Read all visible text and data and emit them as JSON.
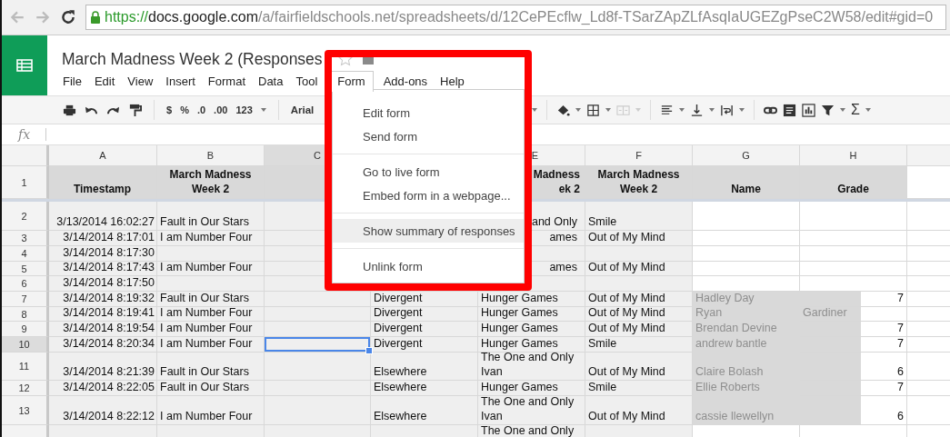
{
  "browser": {
    "url_scheme": "https://",
    "url_host": "docs.google.com",
    "url_path": "/a/fairfieldschools.net/spreadsheets/d/12CePEcflw_Ld8f-TSarZApZLfAsqIaUGEZgPseC2W58/edit#gid=0"
  },
  "document": {
    "title": "March Madness Week 2 (Responses",
    "starred": false
  },
  "menubar": [
    {
      "label": "File",
      "selected": false
    },
    {
      "label": "Edit",
      "selected": false
    },
    {
      "label": "View",
      "selected": false
    },
    {
      "label": "Insert",
      "selected": false
    },
    {
      "label": "Format",
      "selected": false
    },
    {
      "label": "Data",
      "selected": false
    },
    {
      "label": "Tool",
      "selected": false
    },
    {
      "label": "Form",
      "selected": true
    },
    {
      "label": "Add-ons",
      "selected": false
    },
    {
      "label": "Help",
      "selected": false
    }
  ],
  "toolbar": {
    "number_buttons": [
      "$",
      "%",
      ".0",
      ".00",
      "123"
    ],
    "font": "Arial",
    "sum": "Σ"
  },
  "formula_bar": {
    "label": "fx"
  },
  "form_menu": [
    {
      "label": "Edit form",
      "kind": "item",
      "selected": false
    },
    {
      "label": "Send form",
      "kind": "item",
      "selected": false
    },
    {
      "kind": "separator"
    },
    {
      "label": "Go to live form",
      "kind": "item",
      "selected": false
    },
    {
      "label": "Embed form in a webpage...",
      "kind": "item",
      "selected": false
    },
    {
      "kind": "separator"
    },
    {
      "label": "Show summary of responses",
      "kind": "item",
      "selected": true
    },
    {
      "kind": "separator"
    },
    {
      "label": "Unlink form",
      "kind": "item",
      "selected": false
    }
  ],
  "columns": [
    {
      "label": "A",
      "selected": false
    },
    {
      "label": "B",
      "selected": false
    },
    {
      "label": "C",
      "selected": true
    },
    {
      "label": "E",
      "selected": false
    },
    {
      "label": "F",
      "selected": false
    },
    {
      "label": "G",
      "selected": false
    },
    {
      "label": "H",
      "selected": false
    }
  ],
  "rows": [
    {
      "number": "1",
      "selected": false,
      "cells": {
        "A": "Timestamp",
        "B": "March Madness Week 2",
        "E": "Madness\nek 2",
        "F": "March Madness Week 2",
        "G": "Name",
        "H": "Grade"
      }
    },
    {
      "number": "2",
      "selected": false,
      "cells": {
        "A": "3/13/2014 16:02:27",
        "B": "Fault in Our Stars",
        "E": "and Only",
        "F": "Smile"
      }
    },
    {
      "number": "3",
      "selected": false,
      "cells": {
        "A": "3/14/2014 8:17:01",
        "B": "I am Number Four",
        "E": "ames",
        "F": "Out of My Mind"
      }
    },
    {
      "number": "4",
      "selected": false,
      "cells": {
        "A": "3/14/2014 8:17:30"
      }
    },
    {
      "number": "5",
      "selected": false,
      "cells": {
        "A": "3/14/2014 8:17:43",
        "B": "I am Number Four",
        "E": "ames",
        "F": "Out of My Mind"
      }
    },
    {
      "number": "6",
      "selected": false,
      "cells": {
        "A": "3/14/2014 8:17:50"
      }
    },
    {
      "number": "7",
      "selected": false,
      "cells": {
        "A": "3/14/2014 8:19:32",
        "B": "Fault in Our Stars",
        "D": "Divergent",
        "E": "Hunger Games",
        "F": "Out of My Mind",
        "G": {
          "text": "Hadley Day",
          "kind": "faint"
        },
        "H": {
          "text": "7",
          "kind": "number"
        }
      }
    },
    {
      "number": "8",
      "selected": false,
      "cells": {
        "A": "3/14/2014 8:19:41",
        "B": "I am Number Four",
        "D": "Divergent",
        "E": "Hunger Games",
        "F": "Out of My Mind",
        "G": {
          "text": "Ryan",
          "kind": "faint"
        },
        "H": {
          "text": "Gardiner",
          "kind": "faint"
        }
      }
    },
    {
      "number": "9",
      "selected": false,
      "cells": {
        "A": "3/14/2014 8:19:54",
        "B": "I am Number Four",
        "D": "Divergent",
        "E": "Hunger Games",
        "F": "Out of My Mind",
        "G": {
          "text": "Brendan Devine",
          "kind": "faint"
        },
        "H": {
          "text": "7",
          "kind": "number"
        }
      }
    },
    {
      "number": "10",
      "selected": true,
      "cells": {
        "A": "3/14/2014 8:20:34",
        "B": "I am Number Four",
        "D": "Divergent",
        "E": "Hunger Games",
        "F": "Smile",
        "G": {
          "text": "andrew bantle",
          "kind": "faint"
        },
        "H": {
          "text": "7",
          "kind": "number"
        }
      }
    },
    {
      "number": "11",
      "selected": false,
      "cells": {
        "A": "3/14/2014 8:21:39",
        "B": "Fault in Our Stars",
        "D": "Elsewhere",
        "E": "The One and Only Ivan",
        "F": "Out of My Mind",
        "G": {
          "text": "Claire Bolash",
          "kind": "faint"
        },
        "H": {
          "text": "6",
          "kind": "number"
        }
      }
    },
    {
      "number": "12",
      "selected": false,
      "cells": {
        "A": "3/14/2014 8:22:05",
        "B": "Fault in Our Stars",
        "D": "Elsewhere",
        "E": "Hunger Games",
        "F": "Smile",
        "G": {
          "text": "Ellie Roberts",
          "kind": "faint"
        },
        "H": {
          "text": "7",
          "kind": "number"
        }
      }
    },
    {
      "number": "13",
      "selected": false,
      "cells": {
        "A": "3/14/2014 8:22:12",
        "B": "I am Number Four",
        "D": "Elsewhere",
        "E": "The One and Only Ivan",
        "F": "Out of My Mind",
        "G": {
          "text": "cassie llewellyn",
          "kind": "faint"
        },
        "H": {
          "text": "6",
          "kind": "number"
        }
      }
    },
    {
      "selected": false,
      "cells": {
        "E": "The One and Only"
      }
    }
  ]
}
